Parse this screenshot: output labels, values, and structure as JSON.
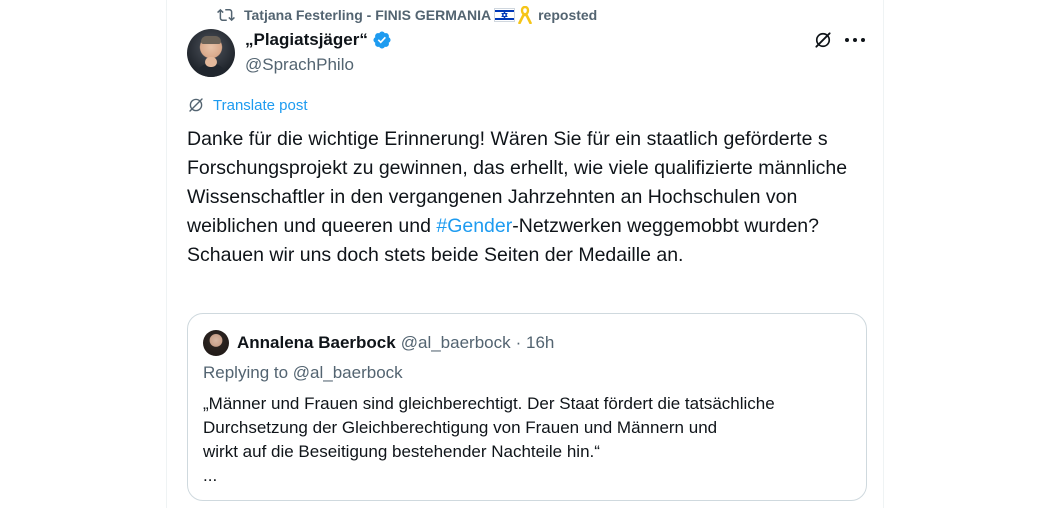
{
  "repost": {
    "user": "Tatjana Festerling - FINIS GERMANIA",
    "suffix": "reposted",
    "icons": [
      "repost-icon",
      "israel-flag-icon",
      "yellow-ribbon-icon"
    ]
  },
  "post": {
    "display_name": "„Plagiatsjäger“",
    "handle": "@SprachPhilo",
    "translate_label": "Translate post",
    "text_before_hashtag": "Danke für die wichtige Erinnerung! Wären Sie für ein staatlich geförderte s Forschungsprojekt zu gewinnen, das erhellt, wie viele qualifizierte männliche Wissenschaftler in den vergangenen Jahrzehnten an Hochschulen von weiblichen und queeren und ",
    "hashtag": "#Gender",
    "text_after_hashtag": "-Netzwerken weggemobbt wurden? Schauen wir uns doch stets beide Seiten der Medaille an."
  },
  "quote": {
    "display_name": "Annalena Baerbock",
    "handle": "@al_baerbock",
    "time": "· 16h",
    "replying_to": "Replying to @al_baerbock",
    "text": "„Männer und Frauen sind gleichberechtigt. Der Staat fördert die tatsächliche\nDurchsetzung der Gleichberechtigung von Frauen und Männern und\nwirkt auf die Beseitigung bestehender Nachteile hin.“\n..."
  },
  "colors": {
    "accent": "#1d9bf0",
    "secondary_text": "#536471",
    "primary_text": "#0f1419",
    "border": "#cfd9de"
  }
}
